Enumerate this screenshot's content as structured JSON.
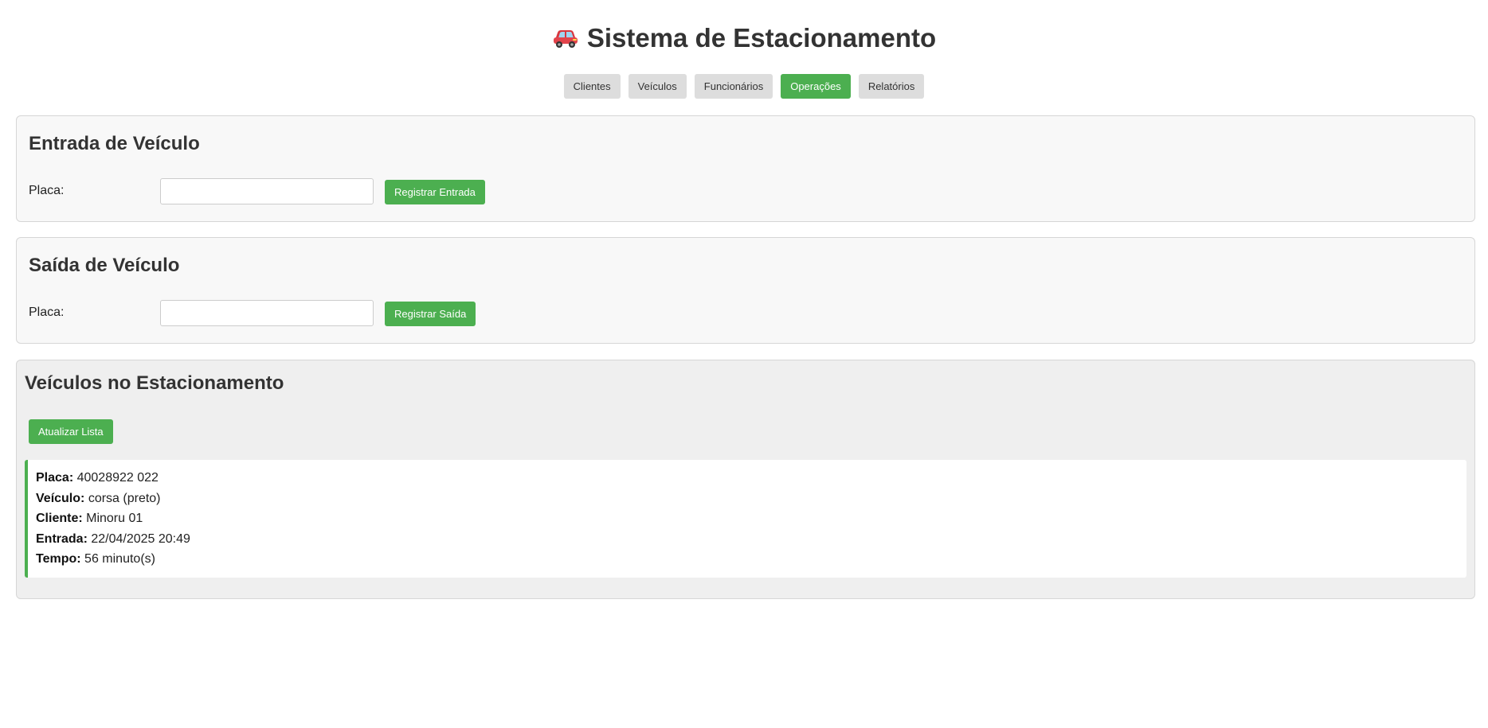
{
  "header": {
    "title": "Sistema de Estacionamento",
    "icon": "car-icon"
  },
  "nav": {
    "items": [
      {
        "label": "Clientes",
        "active": false
      },
      {
        "label": "Veículos",
        "active": false
      },
      {
        "label": "Funcionários",
        "active": false
      },
      {
        "label": "Operações",
        "active": true
      },
      {
        "label": "Relatórios",
        "active": false
      }
    ]
  },
  "entrada": {
    "title": "Entrada de Veículo",
    "placa_label": "Placa:",
    "placa_value": "",
    "button_label": "Registrar Entrada"
  },
  "saida": {
    "title": "Saída de Veículo",
    "placa_label": "Placa:",
    "placa_value": "",
    "button_label": "Registrar Saída"
  },
  "veiculos": {
    "title": "Veículos no Estacionamento",
    "refresh_label": "Atualizar Lista",
    "list": [
      {
        "placa_label": "Placa:",
        "placa": "40028922 022",
        "veiculo_label": "Veículo:",
        "veiculo": "corsa (preto)",
        "cliente_label": "Cliente:",
        "cliente": "Minoru 01",
        "entrada_label": "Entrada:",
        "entrada": "22/04/2025 20:49",
        "tempo_label": "Tempo:",
        "tempo": "56 minuto(s)"
      }
    ]
  },
  "colors": {
    "accent": "#4caf50",
    "nav_inactive": "#dddddd",
    "panel_bg": "#f8f8f8",
    "list_panel_bg": "#efefef"
  }
}
